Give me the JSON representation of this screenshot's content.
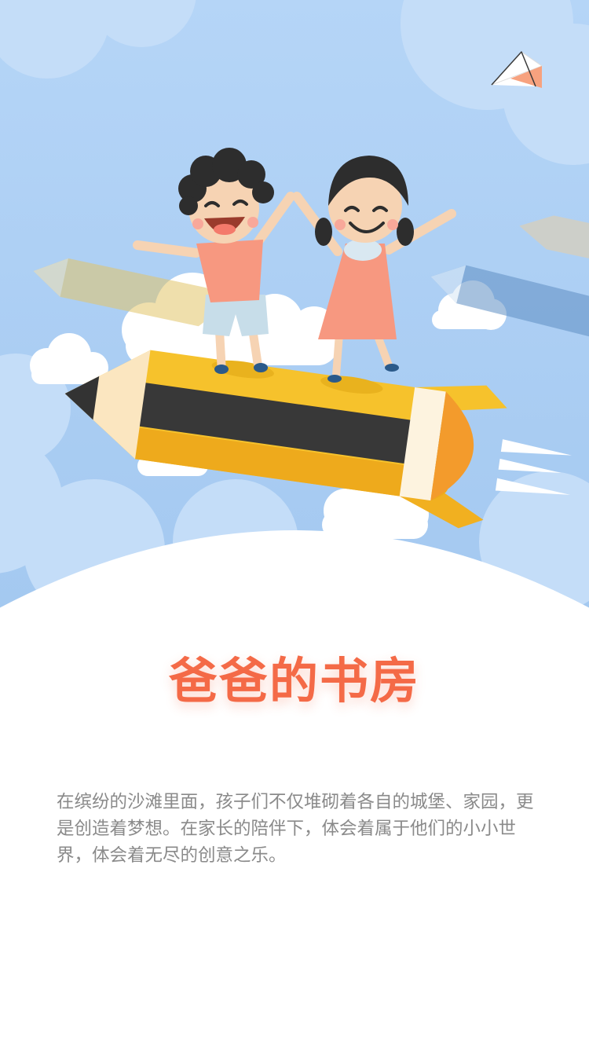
{
  "hero": {
    "icon": "paper-plane-icon",
    "illustration": "kids-riding-pencil-rocket"
  },
  "title": "爸爸的书房",
  "description": "在缤纷的沙滩里面，孩子们不仅堆砌着各自的城堡、家园，更是创造着梦想。在家长的陪伴下，体会着属于他们的小小世界，体会着无尽的创意之乐。",
  "colors": {
    "sky": "#a9cdf4",
    "title": "#f46a47",
    "body_text": "#8a8a8a",
    "rocket": "#f6c22c"
  }
}
